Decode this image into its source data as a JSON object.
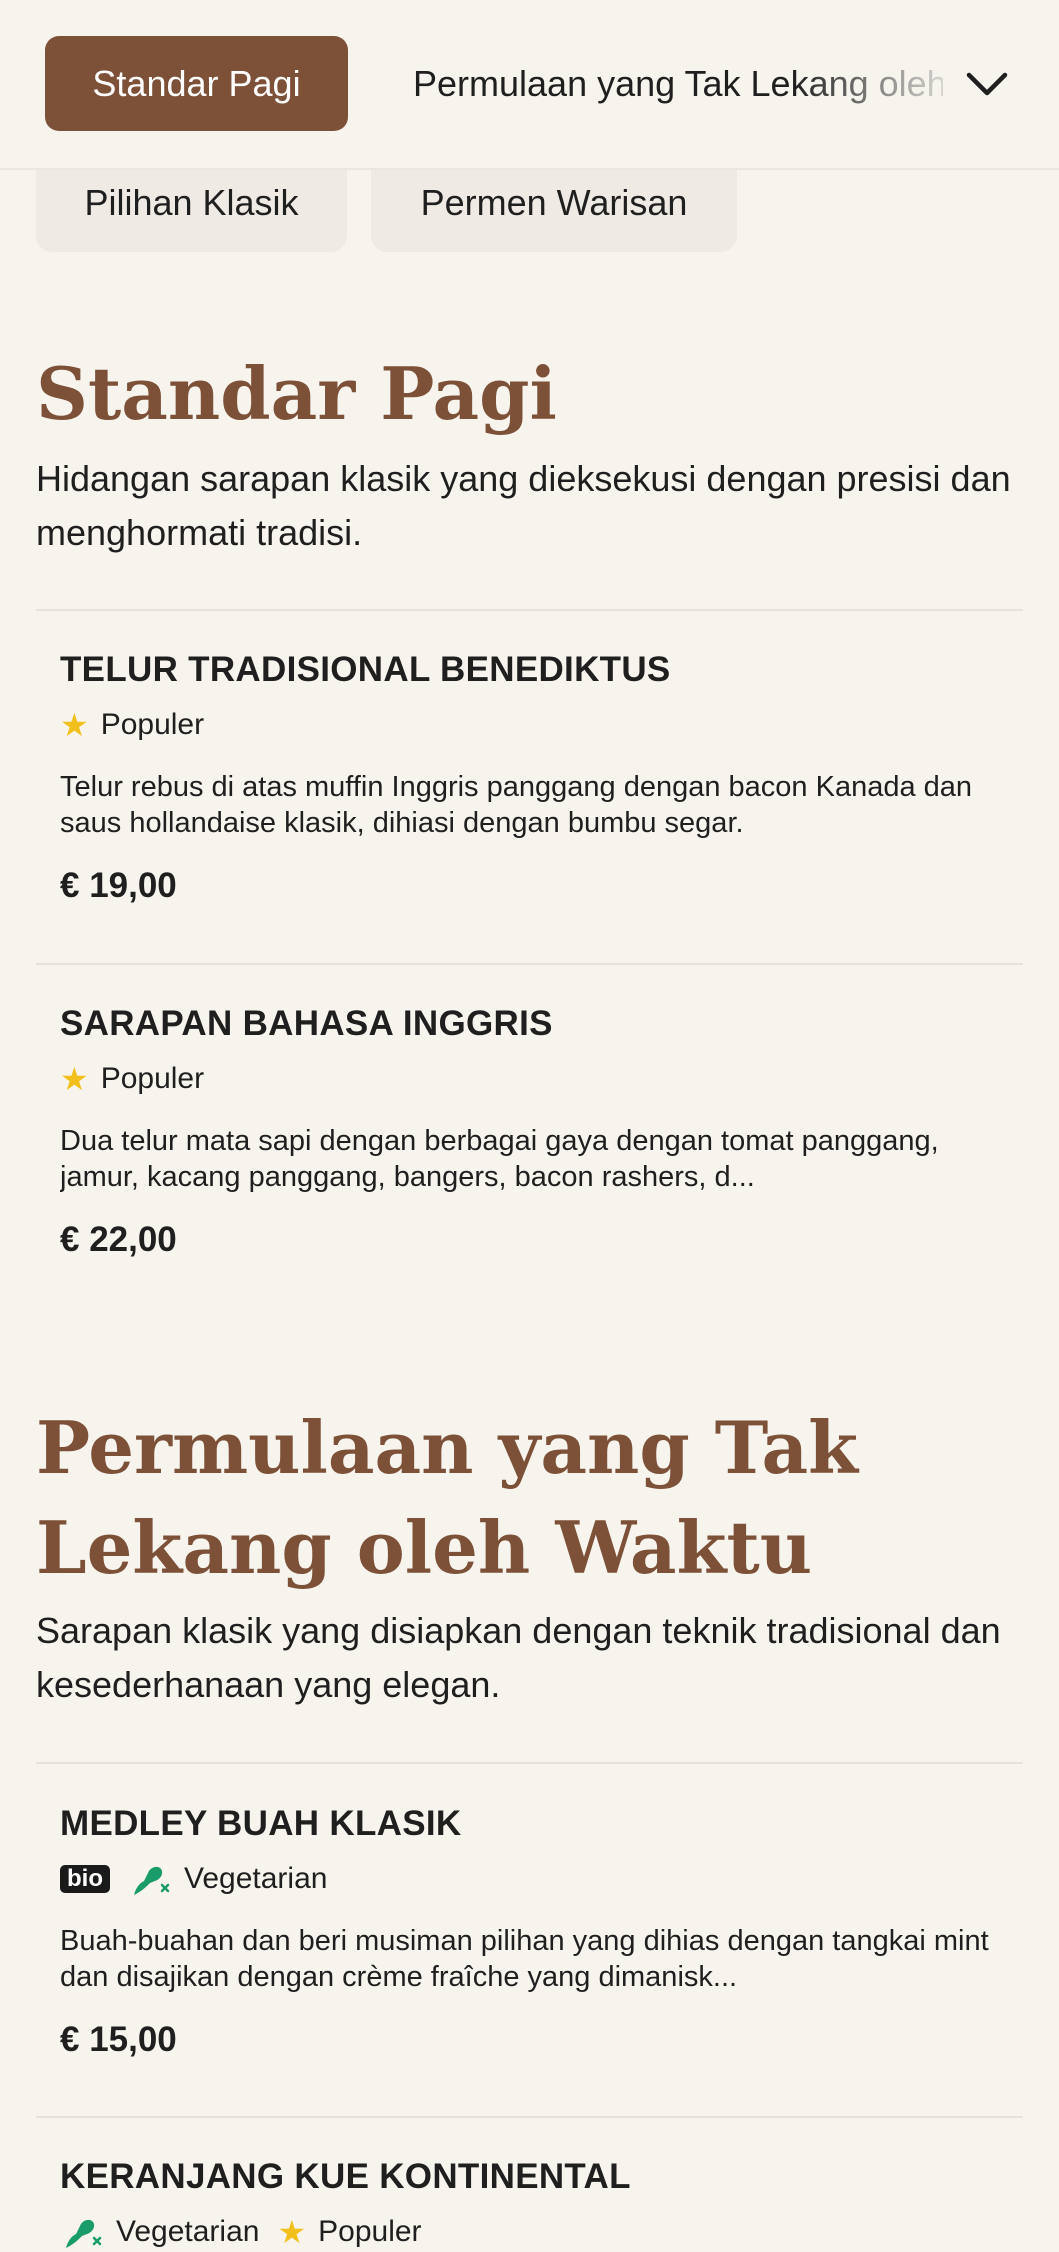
{
  "nav": {
    "active_label": "Standar Pagi",
    "next_label": "Permulaan yang Tak Lekang oleh Waktu",
    "menu_icon": "chevron-down-icon"
  },
  "tabs": [
    "Pilihan Klasik",
    "Permen Warisan"
  ],
  "colors": {
    "accent": "#7c5138",
    "background": "#f7f4ee",
    "star": "#f2c01c",
    "vegetarian": "#1a9b6a"
  },
  "sections": [
    {
      "title": "Standar Pagi",
      "description": "Hidangan sarapan klasik yang dieksekusi dengan presisi dan menghormati tradisi.",
      "items": [
        {
          "name": "TELUR TRADISIONAL BENEDIKTUS",
          "tags": [
            "Populer"
          ],
          "description": "Telur rebus di atas muffin Inggris panggang dengan bacon Kanada dan saus hollandaise klasik, dihiasi dengan bumbu segar.",
          "price": "€ 19,00"
        },
        {
          "name": "SARAPAN BAHASA INGGRIS",
          "tags": [
            "Populer"
          ],
          "description": "Dua telur mata sapi dengan berbagai gaya dengan tomat panggang, jamur, kacang panggang, bangers, bacon rashers, d...",
          "price": "€ 22,00"
        }
      ]
    },
    {
      "title": "Permulaan yang Tak Lekang oleh Waktu",
      "description": "Sarapan klasik yang disiapkan dengan teknik tradisional dan kesederhanaan yang elegan.",
      "items": [
        {
          "name": "MEDLEY BUAH KLASIK",
          "badge": "bio",
          "tags": [
            "Vegetarian"
          ],
          "description": "Buah-buahan dan beri musiman pilihan yang dihias dengan tangkai mint dan disajikan dengan crème fraîche yang dimanisk...",
          "price": "€ 15,00"
        },
        {
          "name": "KERANJANG KUE KONTINENTAL",
          "tags": [
            "Vegetarian",
            "Populer"
          ]
        }
      ]
    }
  ]
}
